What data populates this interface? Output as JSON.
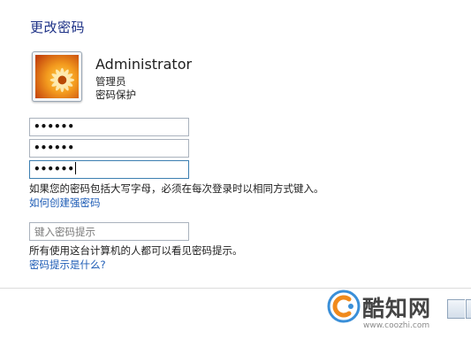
{
  "page": {
    "title": "更改密码"
  },
  "user": {
    "name": "Administrator",
    "role": "管理员",
    "status": "密码保护"
  },
  "password_fields": {
    "current": "••••••",
    "new": "••••••",
    "confirm": "••••••"
  },
  "notes": {
    "case_sensitive": "如果您的密码包括大写字母，必须在每次登录时以相同方式键入。",
    "strong_password_link": "如何创建强密码",
    "hint_visibility": "所有使用这台计算机的人都可以看见密码提示。",
    "hint_help_link": "密码提示是什么?"
  },
  "hint": {
    "placeholder": "键入密码提示",
    "value": ""
  },
  "watermark": {
    "name": "酷知网",
    "url": "www.coozhi.com"
  },
  "colors": {
    "title": "#1e3287",
    "link": "#1c5bb5",
    "field_border": "#aab2bd",
    "focus_border": "#3c7fb1"
  },
  "icons": {
    "avatar": "orange-flower-picture",
    "watermark_logo": "coozhi-logo"
  }
}
